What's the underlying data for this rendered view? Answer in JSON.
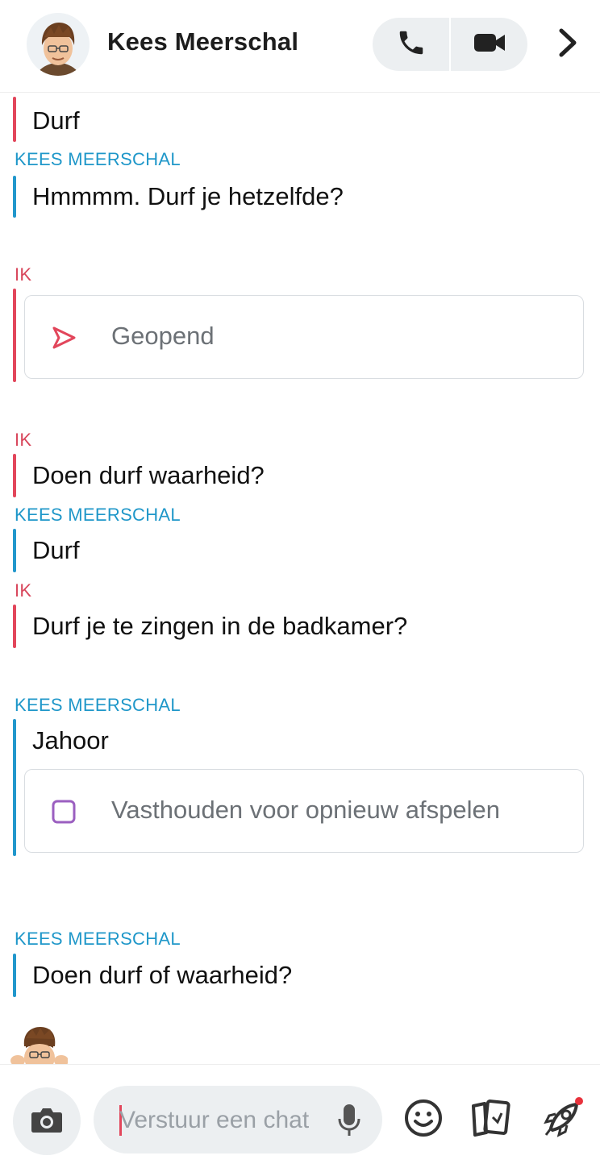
{
  "header": {
    "contact_name": "Kees Meerschal",
    "call_icon": "phone-icon",
    "video_icon": "video-camera-icon",
    "more_icon": "chevron-right-icon"
  },
  "chat": {
    "messages": [
      {
        "sender": "",
        "side": "me",
        "text": "Durf"
      },
      {
        "sender": "KEES MEERSCHAL",
        "side": "friend",
        "text": "Hmmmm. Durf je hetzelfde?"
      },
      {
        "sender": "IK",
        "side": "me",
        "snap_status": "Geopend",
        "snap_icon": "sent-arrow-icon"
      },
      {
        "sender": "IK",
        "side": "me",
        "text": "Doen durf waarheid?"
      },
      {
        "sender": "KEES MEERSCHAL",
        "side": "friend",
        "text": "Durf"
      },
      {
        "sender": "IK",
        "side": "me",
        "text": "Durf je te zingen in de badkamer?"
      },
      {
        "sender": "KEES MEERSCHAL",
        "side": "friend",
        "text": "Jahoor",
        "snap_status": "Vasthouden voor opnieuw afspelen",
        "snap_icon": "replay-square-icon"
      },
      {
        "sender": "KEES MEERSCHAL",
        "side": "friend",
        "text": "Doen durf of waarheid?"
      }
    ]
  },
  "footer": {
    "input_placeholder": "Verstuur een chat",
    "camera_icon": "camera-icon",
    "mic_icon": "microphone-icon",
    "emoji_icon": "smiley-icon",
    "stickers_icon": "cards-icon",
    "games_icon": "rocket-icon"
  },
  "colors": {
    "me": "#e2465b",
    "friend": "#2197cc",
    "snap_sent": "#e2465b",
    "snap_replay": "#9b5fc0",
    "notification_dot": "#e8323c"
  }
}
